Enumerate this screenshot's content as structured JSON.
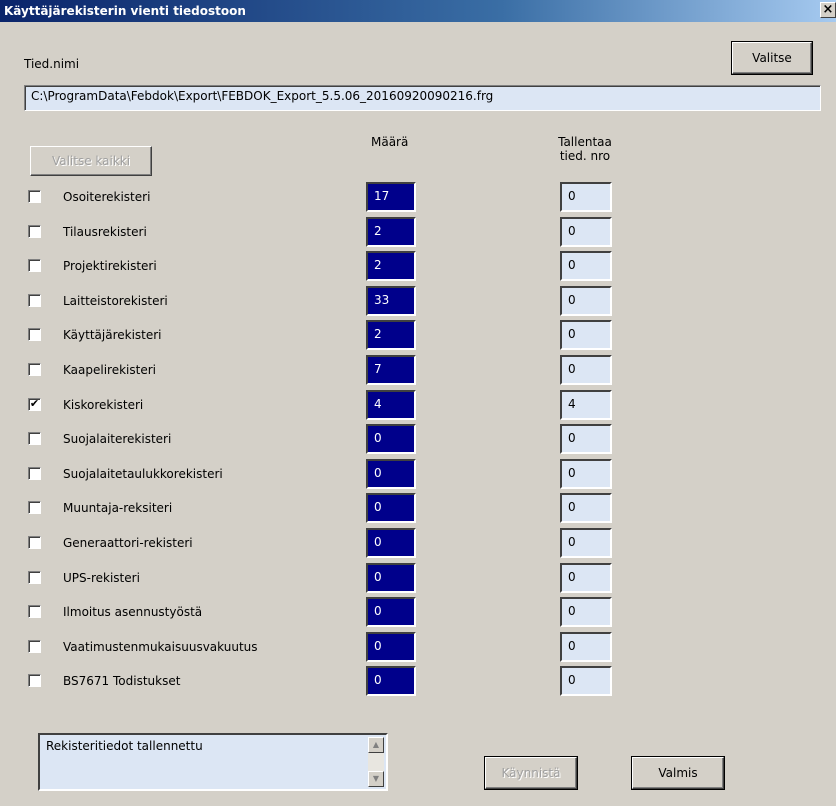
{
  "window": {
    "title": "Käyttäjärekisterin vienti tiedostoon",
    "close_label": "×"
  },
  "file": {
    "label": "Tied.nimi",
    "value": "C:\\ProgramData\\Febdok\\Export\\FEBDOK_Export_5.5.06_20160920090216.frg",
    "select_button": "Valitse"
  },
  "columns": {
    "count": "Määrä",
    "saved_line1": "Tallentaa",
    "saved_line2": "tied. nro"
  },
  "select_all_button": "Valitse kaikki",
  "registers": [
    {
      "label": "Osoiterekisteri",
      "checked": "",
      "count": "17",
      "saved": "0"
    },
    {
      "label": "Tilausrekisteri",
      "checked": "",
      "count": "2",
      "saved": "0"
    },
    {
      "label": "Projektirekisteri",
      "checked": "",
      "count": "2",
      "saved": "0"
    },
    {
      "label": "Laitteistorekisteri",
      "checked": "",
      "count": "33",
      "saved": "0"
    },
    {
      "label": "Käyttäjärekisteri",
      "checked": "",
      "count": "2",
      "saved": "0"
    },
    {
      "label": "Kaapelirekisteri",
      "checked": "",
      "count": "7",
      "saved": "0"
    },
    {
      "label": "Kiskorekisteri",
      "checked": "✔",
      "count": "4",
      "saved": "4"
    },
    {
      "label": "Suojalaiterekisteri",
      "checked": "",
      "count": "0",
      "saved": "0"
    },
    {
      "label": "Suojalaitetaulukkorekisteri",
      "checked": "",
      "count": "0",
      "saved": "0"
    },
    {
      "label": "Muuntaja-reksiteri",
      "checked": "",
      "count": "0",
      "saved": "0"
    },
    {
      "label": "Generaattori-rekisteri",
      "checked": "",
      "count": "0",
      "saved": "0"
    },
    {
      "label": "UPS-rekisteri",
      "checked": "",
      "count": "0",
      "saved": "0"
    },
    {
      "label": "Ilmoitus asennustyöstä",
      "checked": "",
      "count": "0",
      "saved": "0"
    },
    {
      "label": "Vaatimustenmukaisuusvakuutus",
      "checked": "",
      "count": "0",
      "saved": "0"
    },
    {
      "label": "BS7671 Todistukset",
      "checked": "",
      "count": "0",
      "saved": "0"
    }
  ],
  "status": {
    "text": "Rekisteritiedot tallennettu",
    "scroll_up": "▲",
    "scroll_down": "▼"
  },
  "actions": {
    "start_button": "Käynnistä",
    "done_button": "Valmis"
  },
  "colors": {
    "count_bg": "#00008b",
    "field_bg": "#dce6f4",
    "window_bg": "#d4d0c8"
  }
}
